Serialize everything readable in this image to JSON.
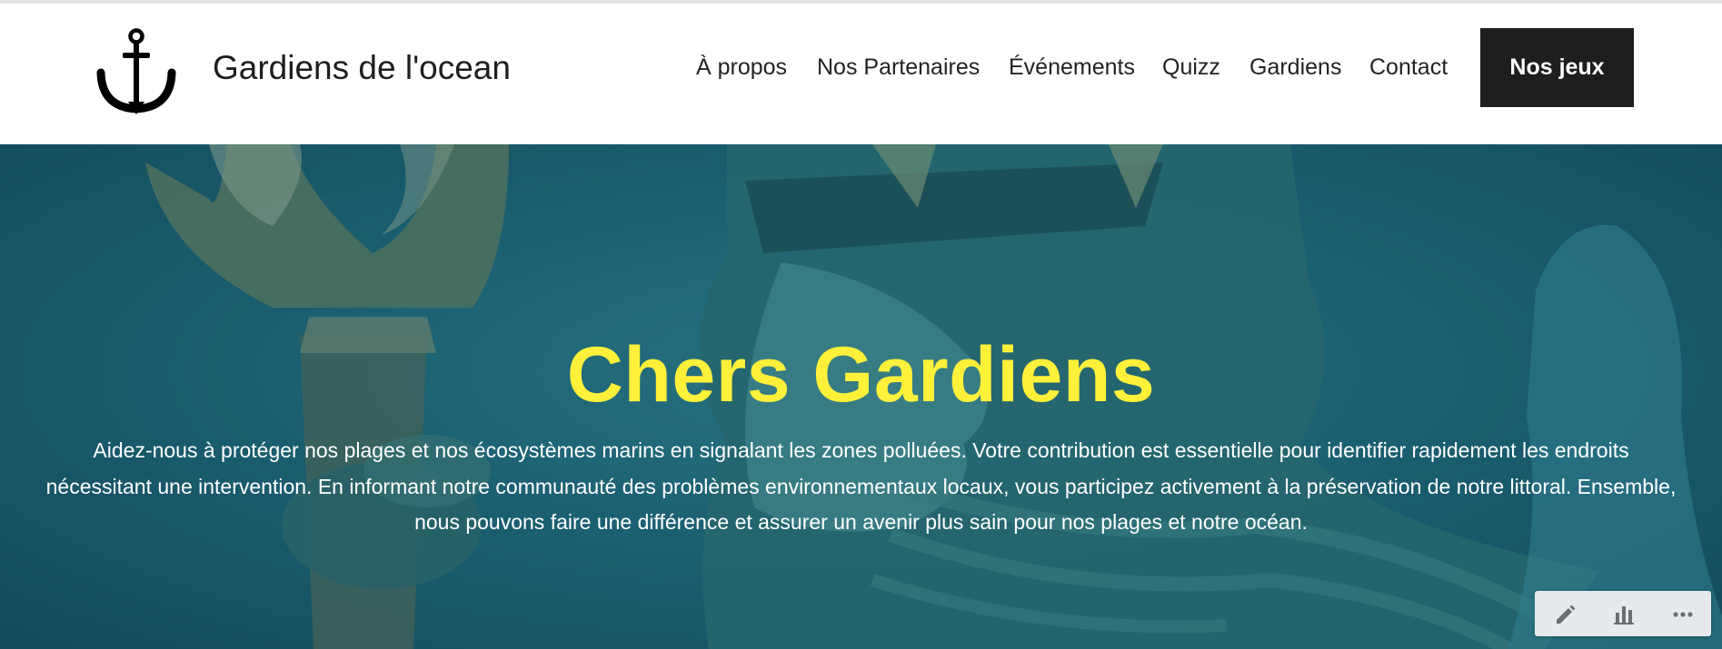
{
  "brand": {
    "name": "Gardiens de l'ocean",
    "logo_icon": "anchor-icon"
  },
  "nav": {
    "items": [
      {
        "label": "À propos"
      },
      {
        "label": "Nos Partenaires"
      },
      {
        "label": "Événements"
      },
      {
        "label": "Quizz"
      },
      {
        "label": "Gardiens"
      },
      {
        "label": "Contact"
      }
    ],
    "cta_label": "Nos jeux"
  },
  "hero": {
    "title": "Chers Gardiens",
    "text": "Aidez-nous à protéger nos plages et nos écosystèmes marins en signalant les zones polluées. Votre contribution est essentielle pour identifier rapidement les endroits nécessitant une intervention. En informant notre communauté des problèmes environnementaux locaux, vous participez activement à la préservation de notre littoral. Ensemble, nous pouvons faire une différence et assurer un avenir plus sain pour nos plages et notre océan.",
    "title_color": "#fff03a",
    "background_color": "#1f6879"
  },
  "toolbar": {
    "tools": [
      {
        "icon": "pencil-icon"
      },
      {
        "icon": "bar-chart-icon"
      },
      {
        "icon": "more-icon"
      }
    ]
  },
  "colors": {
    "cta_bg": "#1e1e1e",
    "text": "#232323"
  }
}
